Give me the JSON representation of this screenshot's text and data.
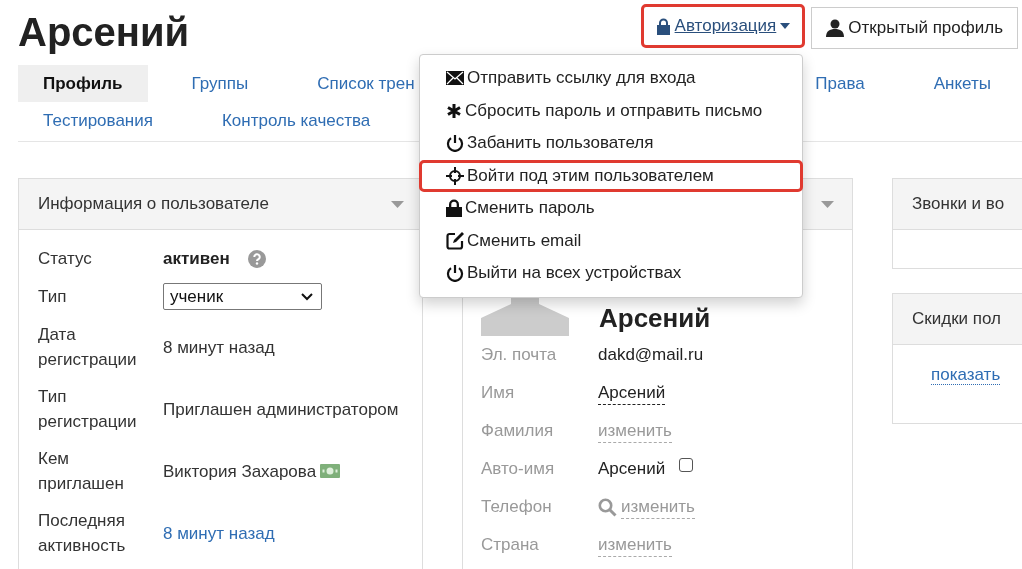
{
  "page_title": "Арсений",
  "header_buttons": [
    {
      "kind": "dropdown",
      "label": "Авторизация",
      "highlighted": true
    },
    {
      "kind": "profile",
      "label": "Открытый профиль",
      "highlighted": false
    }
  ],
  "tab_rows": [
    [
      {
        "label": "Профиль",
        "selected": true
      },
      {
        "label": "Группы",
        "selected": false
      },
      {
        "label": "Список трен",
        "selected": false
      },
      {
        "label": "Права",
        "selected": false
      },
      {
        "label": "Анкеты",
        "selected": false
      }
    ],
    [
      {
        "label": "Тестирования",
        "selected": false
      },
      {
        "label": "Контроль качества",
        "selected": false
      }
    ]
  ],
  "auth_menu": [
    {
      "label": "Отправить ссылку для входа",
      "highlighted": false
    },
    {
      "label": "Сбросить пароль и отправить письмо",
      "highlighted": false
    },
    {
      "label": "Забанить пользователя",
      "highlighted": false
    },
    {
      "label": "Войти под этим пользователем",
      "highlighted": true
    },
    {
      "label": "Сменить пароль",
      "highlighted": false
    },
    {
      "label": "Сменить email",
      "highlighted": false
    },
    {
      "label": "Выйти на всех устройствах",
      "highlighted": false
    }
  ],
  "user_info": {
    "title": "Информация о пользователе",
    "rows": [
      {
        "label": "Статус",
        "value": "активен",
        "kind": "status"
      },
      {
        "label": "Тип",
        "value": "ученик",
        "kind": "select"
      },
      {
        "label": "Дата регистрации",
        "value": "8 минут назад",
        "kind": "text"
      },
      {
        "label": "Тип регистрации",
        "value": "Приглашен администратором",
        "kind": "text"
      },
      {
        "label": "Кем приглашен",
        "value": "Виктория Захарова",
        "kind": "invited"
      },
      {
        "label": "Последняя активность",
        "value": "8 минут назад",
        "kind": "link"
      }
    ]
  },
  "profile_card": {
    "name": "Арсений",
    "fields": [
      {
        "label": "Эл. почта",
        "value": "dakd@mail.ru",
        "kind": "text"
      },
      {
        "label": "Имя",
        "value": "Арсений",
        "kind": "editable"
      },
      {
        "label": "Фамилия",
        "value": "изменить",
        "kind": "empty"
      },
      {
        "label": "Авто-имя",
        "value": "Арсений",
        "kind": "checkbox",
        "checked": false
      },
      {
        "label": "Телефон",
        "value": "изменить",
        "kind": "phone"
      },
      {
        "label": "Страна",
        "value": "изменить",
        "kind": "empty"
      }
    ]
  },
  "side_panels": [
    {
      "title": "Звонки и во"
    },
    {
      "title": "Скидки пол",
      "link": "показать"
    }
  ]
}
